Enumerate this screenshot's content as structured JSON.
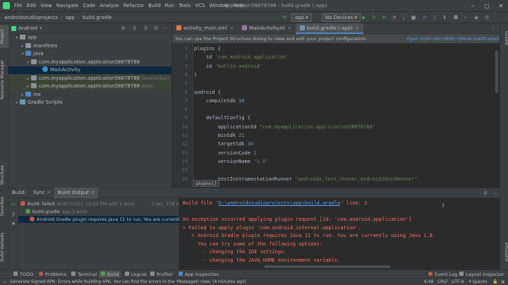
{
  "menu": {
    "items": [
      "File",
      "Edit",
      "View",
      "Navigate",
      "Code",
      "Analyze",
      "Refactor",
      "Build",
      "Run",
      "Tools",
      "VCS",
      "Window",
      "Help"
    ],
    "window_title": "Application58878788 - build.gradle (:app)"
  },
  "navbar": {
    "crumbs": [
      "androidstudioprojects",
      "app",
      "build.gradle"
    ],
    "run_config": "app",
    "device": "No Devices"
  },
  "project_panel": {
    "title": "Android",
    "tree": [
      {
        "label": "app",
        "arrow": "▾",
        "indent": 1,
        "icon": "folder"
      },
      {
        "label": "manifests",
        "arrow": "▸",
        "indent": 2,
        "icon": "folder"
      },
      {
        "label": "java",
        "arrow": "▾",
        "indent": 2,
        "icon": "folder"
      },
      {
        "label": "com.myapplication.application58878788",
        "arrow": "▾",
        "indent": 3,
        "icon": "folder"
      },
      {
        "label": "MainActivity",
        "arrow": "",
        "indent": 5,
        "icon": "class"
      },
      {
        "label": "com.myapplication.application58878788",
        "suffix": "(androidTest)",
        "arrow": "▸",
        "indent": 3,
        "icon": "folder"
      },
      {
        "label": "com.myapplication.application58878788",
        "suffix": "(test)",
        "arrow": "▸",
        "indent": 3,
        "icon": "folder"
      },
      {
        "label": "res",
        "arrow": "▸",
        "indent": 2,
        "icon": "folder"
      },
      {
        "label": "Gradle Scripts",
        "arrow": "▸",
        "indent": 1,
        "icon": "gradle"
      }
    ]
  },
  "left_stripe": [
    "Project",
    "Resource Manager",
    "Structure",
    "Favorites",
    "Build Variants"
  ],
  "right_stripe": [
    "Gradle",
    "Emulator"
  ],
  "editor_tabs": [
    "activity_main.xml",
    "MainActivity.kt",
    "build.gradle (:app)"
  ],
  "banner": {
    "text": "You can use the Project Structure dialog to view and edit your project configuration",
    "open_link": "Open (Ctrl+Alt+Shift+S)",
    "hide_link": "Hide notification"
  },
  "code_lines": [
    {
      "n": "1",
      "text": "plugins {"
    },
    {
      "n": "2",
      "text": "    id 'com.android.application'"
    },
    {
      "n": "3",
      "text": "    id 'kotlin-android'"
    },
    {
      "n": "4",
      "text": "}"
    },
    {
      "n": "5",
      "text": ""
    },
    {
      "n": "6",
      "text": "android {"
    },
    {
      "n": "7",
      "text": "    compileSdk 30"
    },
    {
      "n": "8",
      "text": ""
    },
    {
      "n": "9",
      "text": "    defaultConfig {"
    },
    {
      "n": "10",
      "text": "        applicationId \"com.myapplication.application58878788\""
    },
    {
      "n": "11",
      "text": "        minSdk 21"
    },
    {
      "n": "12",
      "text": "        targetSdk 30"
    },
    {
      "n": "13",
      "text": "        versionCode 1"
    },
    {
      "n": "14",
      "text": "        versionName \"1.0\""
    },
    {
      "n": "15",
      "text": ""
    },
    {
      "n": "16",
      "text": "        testInstrumentationRunner \"androidx.test.runner.AndroidJUnitRunner\""
    }
  ],
  "editor_breadcrumb": "plugins{}",
  "build_panel": {
    "label": "Build:",
    "tabs": [
      "Sync",
      "Build Output"
    ],
    "tree": [
      {
        "status": "Build: failed",
        "detail": "At 8/7/2021 12:00 PM with 1 error",
        "time": "3 sec, 178 ms",
        "kind": "err"
      },
      {
        "status": "build.gradle",
        "detail": "app 1 error",
        "time": "",
        "kind": "ok"
      },
      {
        "status": "Android Gradle plugin requires Java 11 to run. You are currently using Java",
        "detail": "",
        "time": "",
        "kind": "err"
      }
    ],
    "output": [
      {
        "prefix": "Build file '",
        "link": "D:\\androidstudioprojects\\app\\build.gradle",
        "suffix": "' line: 2"
      },
      {
        "prefix": "",
        "link": "",
        "suffix": ""
      },
      {
        "prefix": "An exception occurred applying plugin request [id: 'com.android.application']",
        "link": "",
        "suffix": ""
      },
      {
        "prefix": "> Failed to apply plugin 'com.android.internal.application'.",
        "link": "",
        "suffix": ""
      },
      {
        "prefix": "   > Android Gradle plugin requires Java 11 to run. You are currently using Java 1.8.",
        "link": "",
        "suffix": ""
      },
      {
        "prefix": "     You can try some of the following options:",
        "link": "",
        "suffix": ""
      },
      {
        "prefix": "       - changing the IDE settings.",
        "link": "",
        "suffix": ""
      },
      {
        "prefix": "       - changing the JAVA_HOME environment variable.",
        "link": "",
        "suffix": ""
      }
    ]
  },
  "bottom_tools": [
    "TODO",
    "Problems",
    "Terminal",
    "Build",
    "Logcat",
    "Profiler",
    "App Inspection"
  ],
  "bottom_right_tools": [
    "Event Log",
    "Layout Inspector"
  ],
  "status": {
    "message": "Generate Signed APK: Errors while building APK. You can find the errors in the 'Messages' view. (4 minutes ago)",
    "position": "6:48",
    "line_sep": "CRLF",
    "encoding": "UTF-8",
    "indent": "4 spaces"
  },
  "colors": {
    "accent": "#4a88c7",
    "error": "#ff6b68",
    "ok": "#499c54"
  }
}
